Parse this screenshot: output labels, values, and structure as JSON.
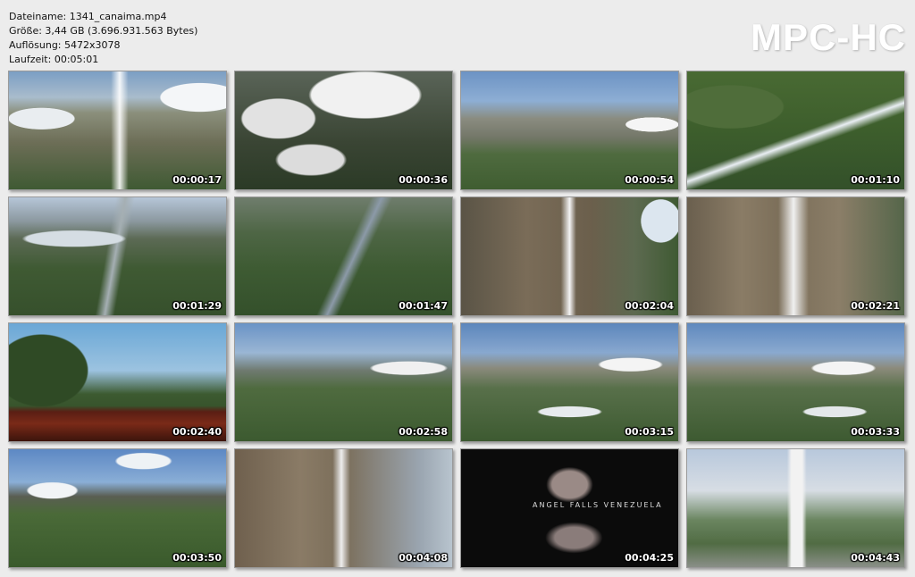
{
  "info": {
    "filename": "Dateiname: 1341_canaima.mp4",
    "size": "Größe: 3,44 GB (3.696.931.563 Bytes)",
    "resolution": "Auflösung: 5472x3078",
    "duration": "Laufzeit: 00:05:01"
  },
  "logo": "MPC-HC",
  "thumbnails": [
    {
      "timestamp": "00:00:17"
    },
    {
      "timestamp": "00:00:36"
    },
    {
      "timestamp": "00:00:54"
    },
    {
      "timestamp": "00:01:10"
    },
    {
      "timestamp": "00:01:29"
    },
    {
      "timestamp": "00:01:47"
    },
    {
      "timestamp": "00:02:04"
    },
    {
      "timestamp": "00:02:21"
    },
    {
      "timestamp": "00:02:40"
    },
    {
      "timestamp": "00:02:58"
    },
    {
      "timestamp": "00:03:15"
    },
    {
      "timestamp": "00:03:33"
    },
    {
      "timestamp": "00:03:50"
    },
    {
      "timestamp": "00:04:08"
    },
    {
      "timestamp": "00:04:25",
      "overlay_text": "ANGEL FALLS VENEZUELA"
    },
    {
      "timestamp": "00:04:43"
    }
  ]
}
